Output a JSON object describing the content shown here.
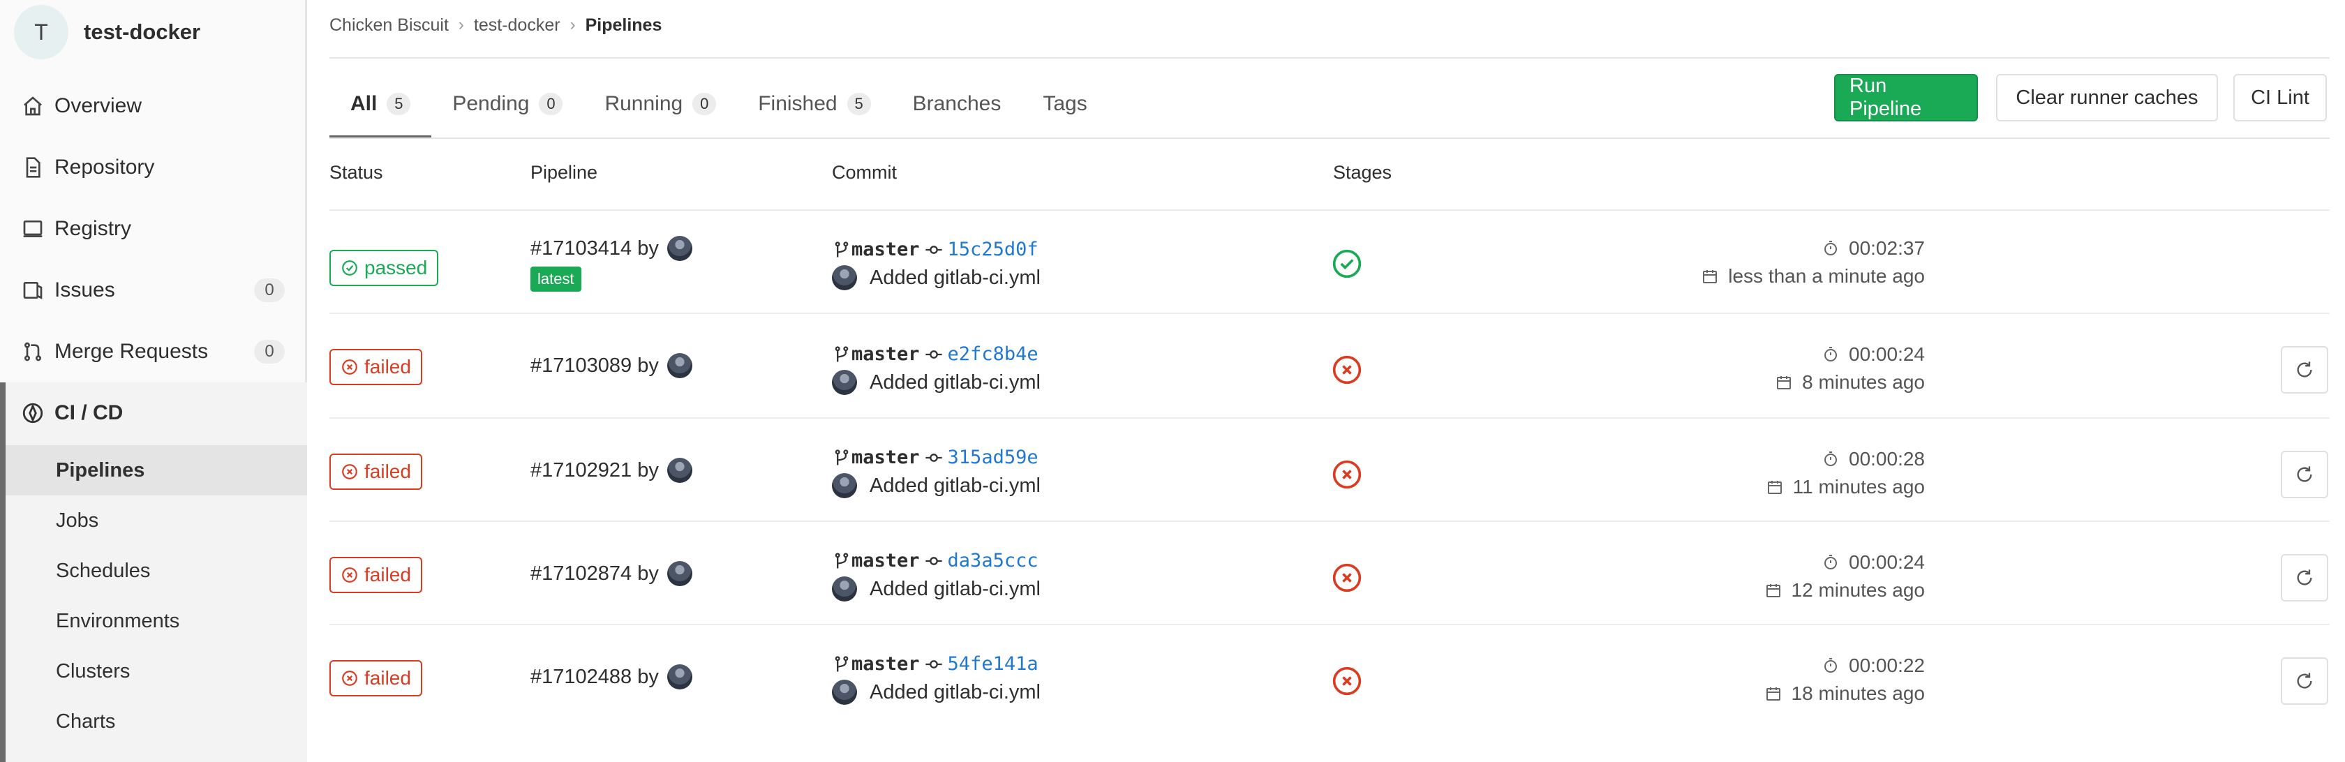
{
  "sidebar": {
    "project_initial": "T",
    "project_name": "test-docker",
    "items": [
      {
        "label": "Overview",
        "icon": "home-icon"
      },
      {
        "label": "Repository",
        "icon": "document-icon"
      },
      {
        "label": "Registry",
        "icon": "container-icon"
      },
      {
        "label": "Issues",
        "icon": "issues-icon",
        "count": "0"
      },
      {
        "label": "Merge Requests",
        "icon": "merge-request-icon",
        "count": "0"
      }
    ],
    "cicd": {
      "label": "CI / CD",
      "icon": "rocket-icon",
      "subitems": [
        "Pipelines",
        "Jobs",
        "Schedules",
        "Environments",
        "Clusters",
        "Charts"
      ],
      "active": "Pipelines"
    }
  },
  "breadcrumb": [
    "Chicken Biscuit",
    "test-docker",
    "Pipelines"
  ],
  "tabs": [
    {
      "label": "All",
      "count": "5",
      "active": true
    },
    {
      "label": "Pending",
      "count": "0"
    },
    {
      "label": "Running",
      "count": "0"
    },
    {
      "label": "Finished",
      "count": "5"
    },
    {
      "label": "Branches"
    },
    {
      "label": "Tags"
    }
  ],
  "buttons": {
    "run_pipeline": "Run Pipeline",
    "clear_runner_caches": "Clear runner caches",
    "ci_lint": "CI Lint"
  },
  "table": {
    "headers": [
      "Status",
      "Pipeline",
      "Commit",
      "Stages"
    ],
    "by_label": "by",
    "latest_badge": "latest",
    "rows": [
      {
        "status": "passed",
        "pipeline": "#17103414",
        "latest": true,
        "branch": "master",
        "sha": "15c25d0f",
        "message": "Added gitlab-ci.yml",
        "stage": "success",
        "duration": "00:02:37",
        "finished": "less than a minute ago",
        "retry": false
      },
      {
        "status": "failed",
        "pipeline": "#17103089",
        "latest": false,
        "branch": "master",
        "sha": "e2fc8b4e",
        "message": "Added gitlab-ci.yml",
        "stage": "failed",
        "duration": "00:00:24",
        "finished": "8 minutes ago",
        "retry": true
      },
      {
        "status": "failed",
        "pipeline": "#17102921",
        "latest": false,
        "branch": "master",
        "sha": "315ad59e",
        "message": "Added gitlab-ci.yml",
        "stage": "failed",
        "duration": "00:00:28",
        "finished": "11 minutes ago",
        "retry": true
      },
      {
        "status": "failed",
        "pipeline": "#17102874",
        "latest": false,
        "branch": "master",
        "sha": "da3a5ccc",
        "message": "Added gitlab-ci.yml",
        "stage": "failed",
        "duration": "00:00:24",
        "finished": "12 minutes ago",
        "retry": true
      },
      {
        "status": "failed",
        "pipeline": "#17102488",
        "latest": false,
        "branch": "master",
        "sha": "54fe141a",
        "message": "Added gitlab-ci.yml",
        "stage": "failed",
        "duration": "00:00:22",
        "finished": "18 minutes ago",
        "retry": true
      }
    ]
  },
  "colors": {
    "success": "#1aaa55",
    "failed": "#db3b21",
    "link": "#1f78d1"
  }
}
